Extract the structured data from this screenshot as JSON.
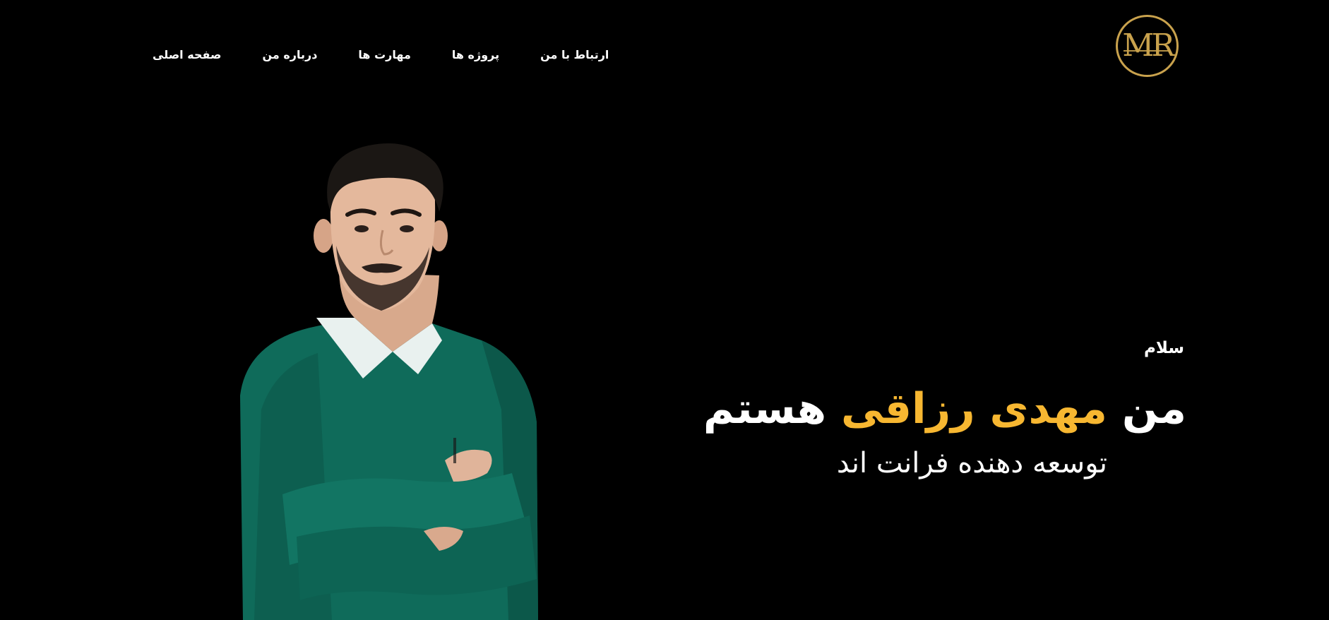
{
  "header": {
    "logo_text": "MR",
    "nav": [
      {
        "label": "صفحه اصلی"
      },
      {
        "label": "درباره من"
      },
      {
        "label": "مهارت ها"
      },
      {
        "label": "پروژه ها"
      },
      {
        "label": "ارتباط با من"
      }
    ]
  },
  "hero": {
    "greeting": "سلام",
    "headline_prefix": "من",
    "name": "مهدی رزاقی",
    "headline_suffix": "هستم",
    "subtitle": "توسعه دهنده فرانت اند"
  },
  "colors": {
    "background": "#000000",
    "accent": "#f7b731",
    "logo_gold": "#c9a24d",
    "sweater": "#0f6b5a"
  }
}
